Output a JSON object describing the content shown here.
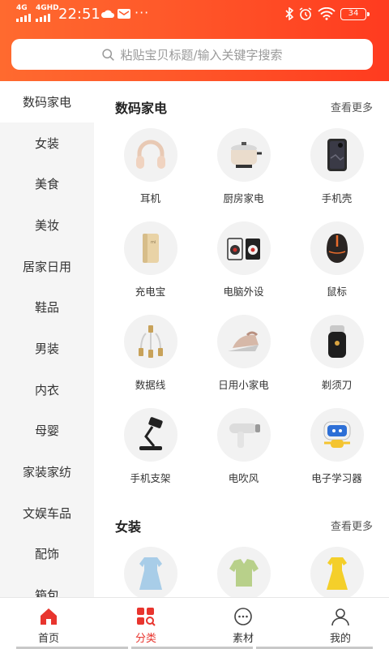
{
  "status_bar": {
    "sig1": "4G",
    "sig2": "4GHD",
    "time": "22:51",
    "dots": "···",
    "battery": "34"
  },
  "search": {
    "placeholder": "粘贴宝贝标题/输入关键字搜索"
  },
  "sidebar": {
    "items": [
      {
        "label": "数码家电",
        "active": true
      },
      {
        "label": "女装"
      },
      {
        "label": "美食"
      },
      {
        "label": "美妆"
      },
      {
        "label": "居家日用"
      },
      {
        "label": "鞋品"
      },
      {
        "label": "男装"
      },
      {
        "label": "内衣"
      },
      {
        "label": "母婴"
      },
      {
        "label": "家装家纺"
      },
      {
        "label": "文娱车品"
      },
      {
        "label": "配饰"
      },
      {
        "label": "箱包"
      }
    ]
  },
  "sections": [
    {
      "title": "数码家电",
      "more": "查看更多",
      "items": [
        {
          "label": "耳机",
          "icon": "headphones-icon"
        },
        {
          "label": "厨房家电",
          "icon": "cooker-icon"
        },
        {
          "label": "手机壳",
          "icon": "phone-case-icon"
        },
        {
          "label": "充电宝",
          "icon": "power-bank-icon"
        },
        {
          "label": "电脑外设",
          "icon": "speakers-icon"
        },
        {
          "label": "鼠标",
          "icon": "mouse-icon"
        },
        {
          "label": "数据线",
          "icon": "cable-icon"
        },
        {
          "label": "日用小家电",
          "icon": "iron-icon"
        },
        {
          "label": "剃须刀",
          "icon": "shaver-icon"
        },
        {
          "label": "手机支架",
          "icon": "phone-stand-icon"
        },
        {
          "label": "电吹风",
          "icon": "hair-dryer-icon"
        },
        {
          "label": "电子学习器",
          "icon": "learning-robot-icon"
        }
      ]
    },
    {
      "title": "女装",
      "more": "查看更多",
      "items": [
        {
          "icon": "dress-blue-icon"
        },
        {
          "icon": "top-green-icon"
        },
        {
          "icon": "dress-yellow-icon"
        }
      ]
    }
  ],
  "tabs": [
    {
      "label": "首页",
      "icon": "home-icon"
    },
    {
      "label": "分类",
      "icon": "category-icon",
      "active": true
    },
    {
      "label": "素材",
      "icon": "material-chat-icon"
    },
    {
      "label": "我的",
      "icon": "profile-icon"
    }
  ],
  "colors": {
    "accent": "#e8352e",
    "header_start": "#ff6a2f",
    "header_end": "#ff3b1f",
    "sidebar_bg": "#f5f5f5"
  }
}
